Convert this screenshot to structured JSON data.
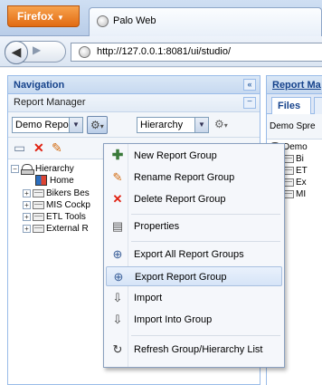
{
  "browser": {
    "menu_button": "Firefox",
    "tab_title": "Palo Web",
    "url": "http://127.0.0.1:8081/ui/studio/"
  },
  "navigation": {
    "title": "Navigation",
    "collapse_glyph": "«",
    "report_manager": "Report Manager",
    "group_combo": "Demo Reports",
    "view_combo": "Hierarchy",
    "tree": [
      {
        "label": "Hierarchy",
        "expander": "−",
        "icon": "hierarchy-icon",
        "level": 0
      },
      {
        "label": "Home",
        "expander": "",
        "icon": "home-icon",
        "level": 2
      },
      {
        "label": "Bikers Bes",
        "expander": "+",
        "icon": "folder-icon",
        "level": 1
      },
      {
        "label": "MIS Cockp",
        "expander": "+",
        "icon": "folder-icon",
        "level": 1
      },
      {
        "label": "ETL Tools",
        "expander": "+",
        "icon": "folder-icon",
        "level": 1
      },
      {
        "label": "External R",
        "expander": "+",
        "icon": "folder-icon",
        "level": 1
      }
    ]
  },
  "report_panel": {
    "title": "Report Ma",
    "files_tab": "Files",
    "combo": "Demo Spre",
    "tree": [
      {
        "label": "Demo",
        "expander": "",
        "icon": "hierarchy-icon"
      },
      {
        "label": "Bi",
        "expander": "+",
        "icon": "folder-icon"
      },
      {
        "label": "ET",
        "expander": "+",
        "icon": "folder-icon"
      },
      {
        "label": "Ex",
        "expander": "+",
        "icon": "folder-icon"
      },
      {
        "label": "MI",
        "expander": "+",
        "icon": "folder-icon"
      }
    ]
  },
  "context_menu": {
    "items": [
      {
        "label": "New Report Group",
        "icon": "plus-icon",
        "highlighted": false
      },
      {
        "label": "Rename Report Group",
        "icon": "rename-icon",
        "highlighted": false
      },
      {
        "label": "Delete Report Group",
        "icon": "delete-icon",
        "highlighted": false
      },
      {
        "label": "Properties",
        "icon": "properties-icon",
        "highlighted": false
      },
      {
        "label": "Export All Report Groups",
        "icon": "globe-icon",
        "highlighted": false
      },
      {
        "label": "Export Report Group",
        "icon": "globe-icon",
        "highlighted": true
      },
      {
        "label": "Import",
        "icon": "import-icon",
        "highlighted": false
      },
      {
        "label": "Import Into Group",
        "icon": "import-icon",
        "highlighted": false
      },
      {
        "label": "Refresh Group/Hierarchy List",
        "icon": "refresh-icon",
        "highlighted": false
      }
    ]
  },
  "colors": {
    "panel_header_text": "#15428b",
    "panel_border": "#99bbe8",
    "firefox_orange": "#e26b12",
    "delete_red": "#e02010"
  }
}
